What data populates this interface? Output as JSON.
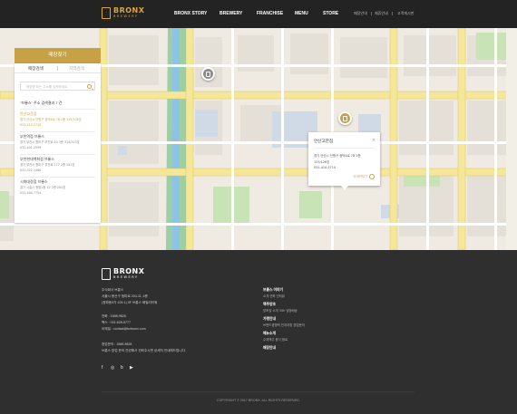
{
  "header": {
    "logo": {
      "text": "BRONX",
      "sub": "BREWERY"
    },
    "nav": [
      "BRONX STORY",
      "BREWERY",
      "FRANCHISE",
      "MENU",
      "STORE"
    ],
    "util": [
      "매장안내",
      "제휴안내",
      "고객게시판"
    ]
  },
  "panel": {
    "title": "매장찾기",
    "tabs": [
      "매장검색",
      "지역검색"
    ],
    "search_placeholder": "매장명 또는 주소를 입력하세요",
    "result_title": "\"브롱스\" 주소 검색결과 7 건",
    "stores": [
      {
        "name": "안산고잔점",
        "address": "경기 안산시 단원구 광덕4로 78 1층 125/126호",
        "phone": "031-414-5710",
        "active": true
      },
      {
        "name": "부천역점 브롱스",
        "address": "경기 부천시 원미구 부천로 40 3층 314/315호",
        "phone": "032-401-2599",
        "active": false
      },
      {
        "name": "부천현대백화점 브롱스",
        "address": "경기 부천시 원미구 부천로 177 2층 201호",
        "phone": "032-322-1460",
        "active": false
      },
      {
        "name": "시화대정점 브롱스",
        "address": "경기 시흥시 정왕2동 12 2층 203호",
        "phone": "031-404-7754",
        "active": false
      }
    ]
  },
  "infowindow": {
    "title": "안산고잔점",
    "close": "×",
    "address_line1": "경기 안산시 단원구 광덕4로 78 1층",
    "address_line2": "125/126호",
    "phone": "031-414-5710",
    "more": "자세히보기"
  },
  "footer": {
    "logo": {
      "text": "BRONX",
      "sub": "BREWERY"
    },
    "company": "주식회사 브롱스",
    "address": "서울시 용산구 청파로 204-11, 4층",
    "address2": "(청파동3가 105-1) 5F 브롱스 패밀리타워",
    "tel": "전화 : 1588-9828",
    "fax": "팩스 : 031-628-5777",
    "email": "이메일 : contact@bzbronx.com",
    "consult": "창업문의 : 1588-9828",
    "consult2": "브롱스 창업 문의 관련해서 전화주시면 상세히 안내해드립니다.",
    "menu": [
      {
        "head": "브롱스 이야기",
        "sub": "소개   연혁   인터뷰"
      },
      {
        "head": "맥주양조",
        "sub": "양조장 소개   34h 냉장배송"
      },
      {
        "head": "가맹안내",
        "sub": "브랜드경쟁력   전개과정   창업문의"
      },
      {
        "head": "메뉴소개",
        "sub": "수제맥주   음식   음료"
      },
      {
        "head": "매장안내",
        "sub": ""
      }
    ],
    "social": [
      "f",
      "◎",
      "b",
      "▶"
    ],
    "copyright": "COPYRIGHT © 2017 BRONX. ALL RIGHTS RESERVED."
  },
  "colors": {
    "accent": "#c6a145",
    "header": "#232323",
    "footer": "#2f2f2f"
  }
}
